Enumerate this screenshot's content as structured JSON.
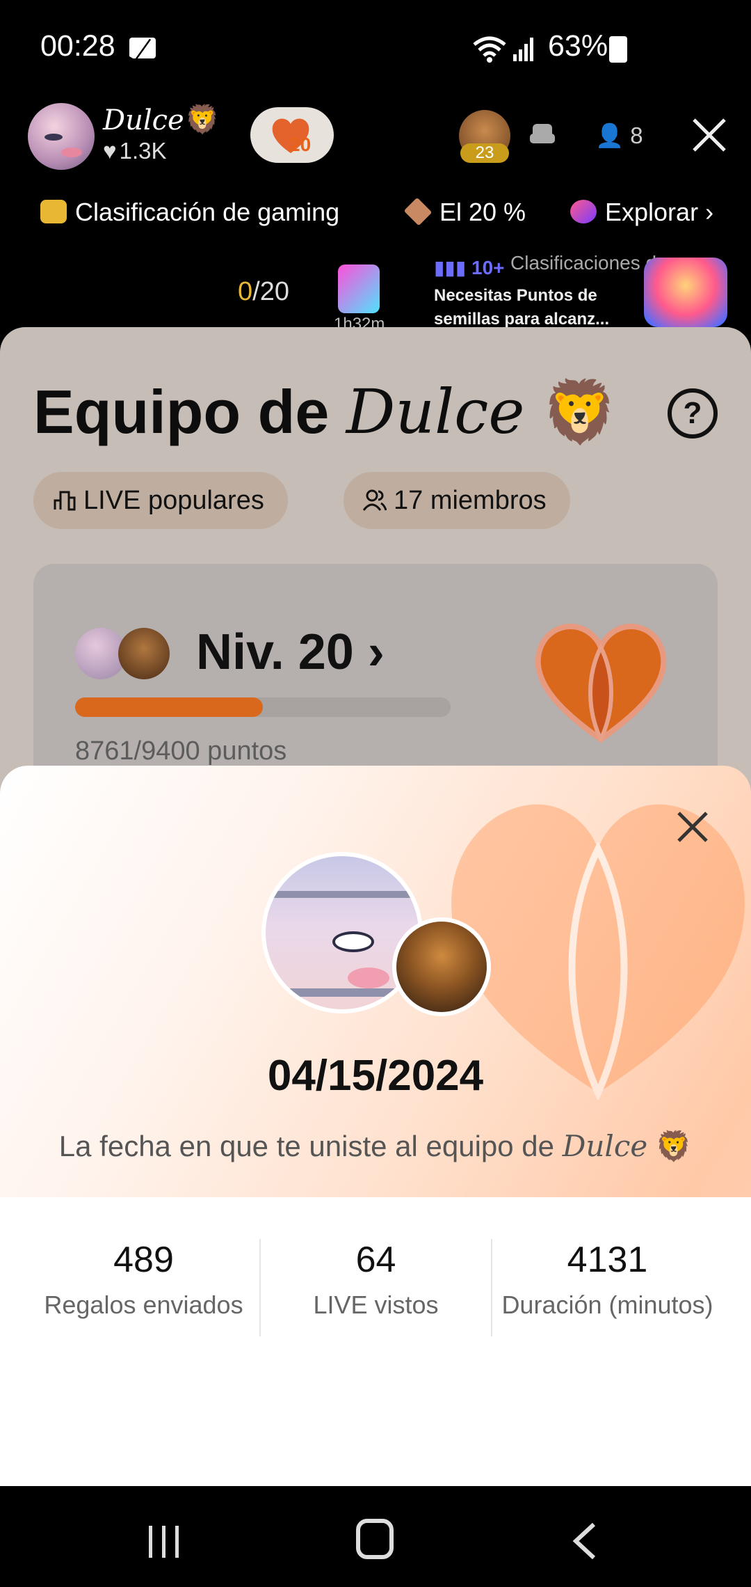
{
  "status_bar": {
    "time": "00:28",
    "battery": "63%"
  },
  "live_header": {
    "host_name": "Dulce",
    "host_emoji": "🦁",
    "host_likes": "1.3K",
    "team_level_badge": "20",
    "top_viewer_badge": "23",
    "viewer_count": "8"
  },
  "promo_row": {
    "item1": "Clasificación de gaming",
    "item2": "El 20 %",
    "item3": "Explorar"
  },
  "ticker": {
    "score_current": "0",
    "score_total": "/20",
    "timer": "1h32m",
    "rank_badge": "10+",
    "rank_title": "Clasificaciones de",
    "rank_subtitle": "Necesitas Puntos de semillas para alcanz..."
  },
  "team_panel": {
    "title_prefix": "Equipo de",
    "title_name": "Dulce",
    "title_emoji": "🦁",
    "help": "?",
    "chip_popular": "LIVE populares",
    "chip_members": "17 miembros",
    "level_label": "Niv. 20",
    "points": "8761/9400 puntos",
    "progress_fraction": 0.5
  },
  "sheet": {
    "date": "04/15/2024",
    "joined_prefix": "La fecha en que te uniste al equipo de",
    "joined_name": "Dulce",
    "joined_emoji": "🦁",
    "stats": [
      {
        "value": "489",
        "label": "Regalos enviados"
      },
      {
        "value": "64",
        "label": "LIVE vistos"
      },
      {
        "value": "4131",
        "label": "Duración (minutos)"
      }
    ]
  },
  "colors": {
    "accent": "#d9681c",
    "gold": "#e8b733",
    "rank_blue": "#6c6cff"
  }
}
